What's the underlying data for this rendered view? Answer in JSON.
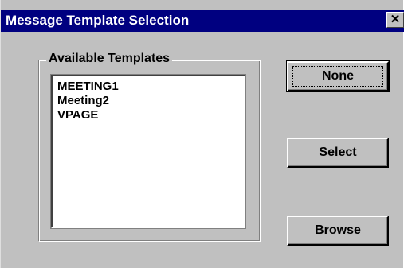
{
  "window": {
    "title": "Message Template Selection",
    "close_glyph": "✕"
  },
  "templates_group": {
    "label": "Available Templates",
    "items": [
      "MEETING1",
      "Meeting2",
      "VPAGE"
    ]
  },
  "buttons": {
    "none_label": "None",
    "select_label": "Select",
    "browse_label": "Browse"
  },
  "colors": {
    "titlebar": "#000080",
    "face": "#c0c0c0",
    "list_bg": "#ffffff"
  }
}
